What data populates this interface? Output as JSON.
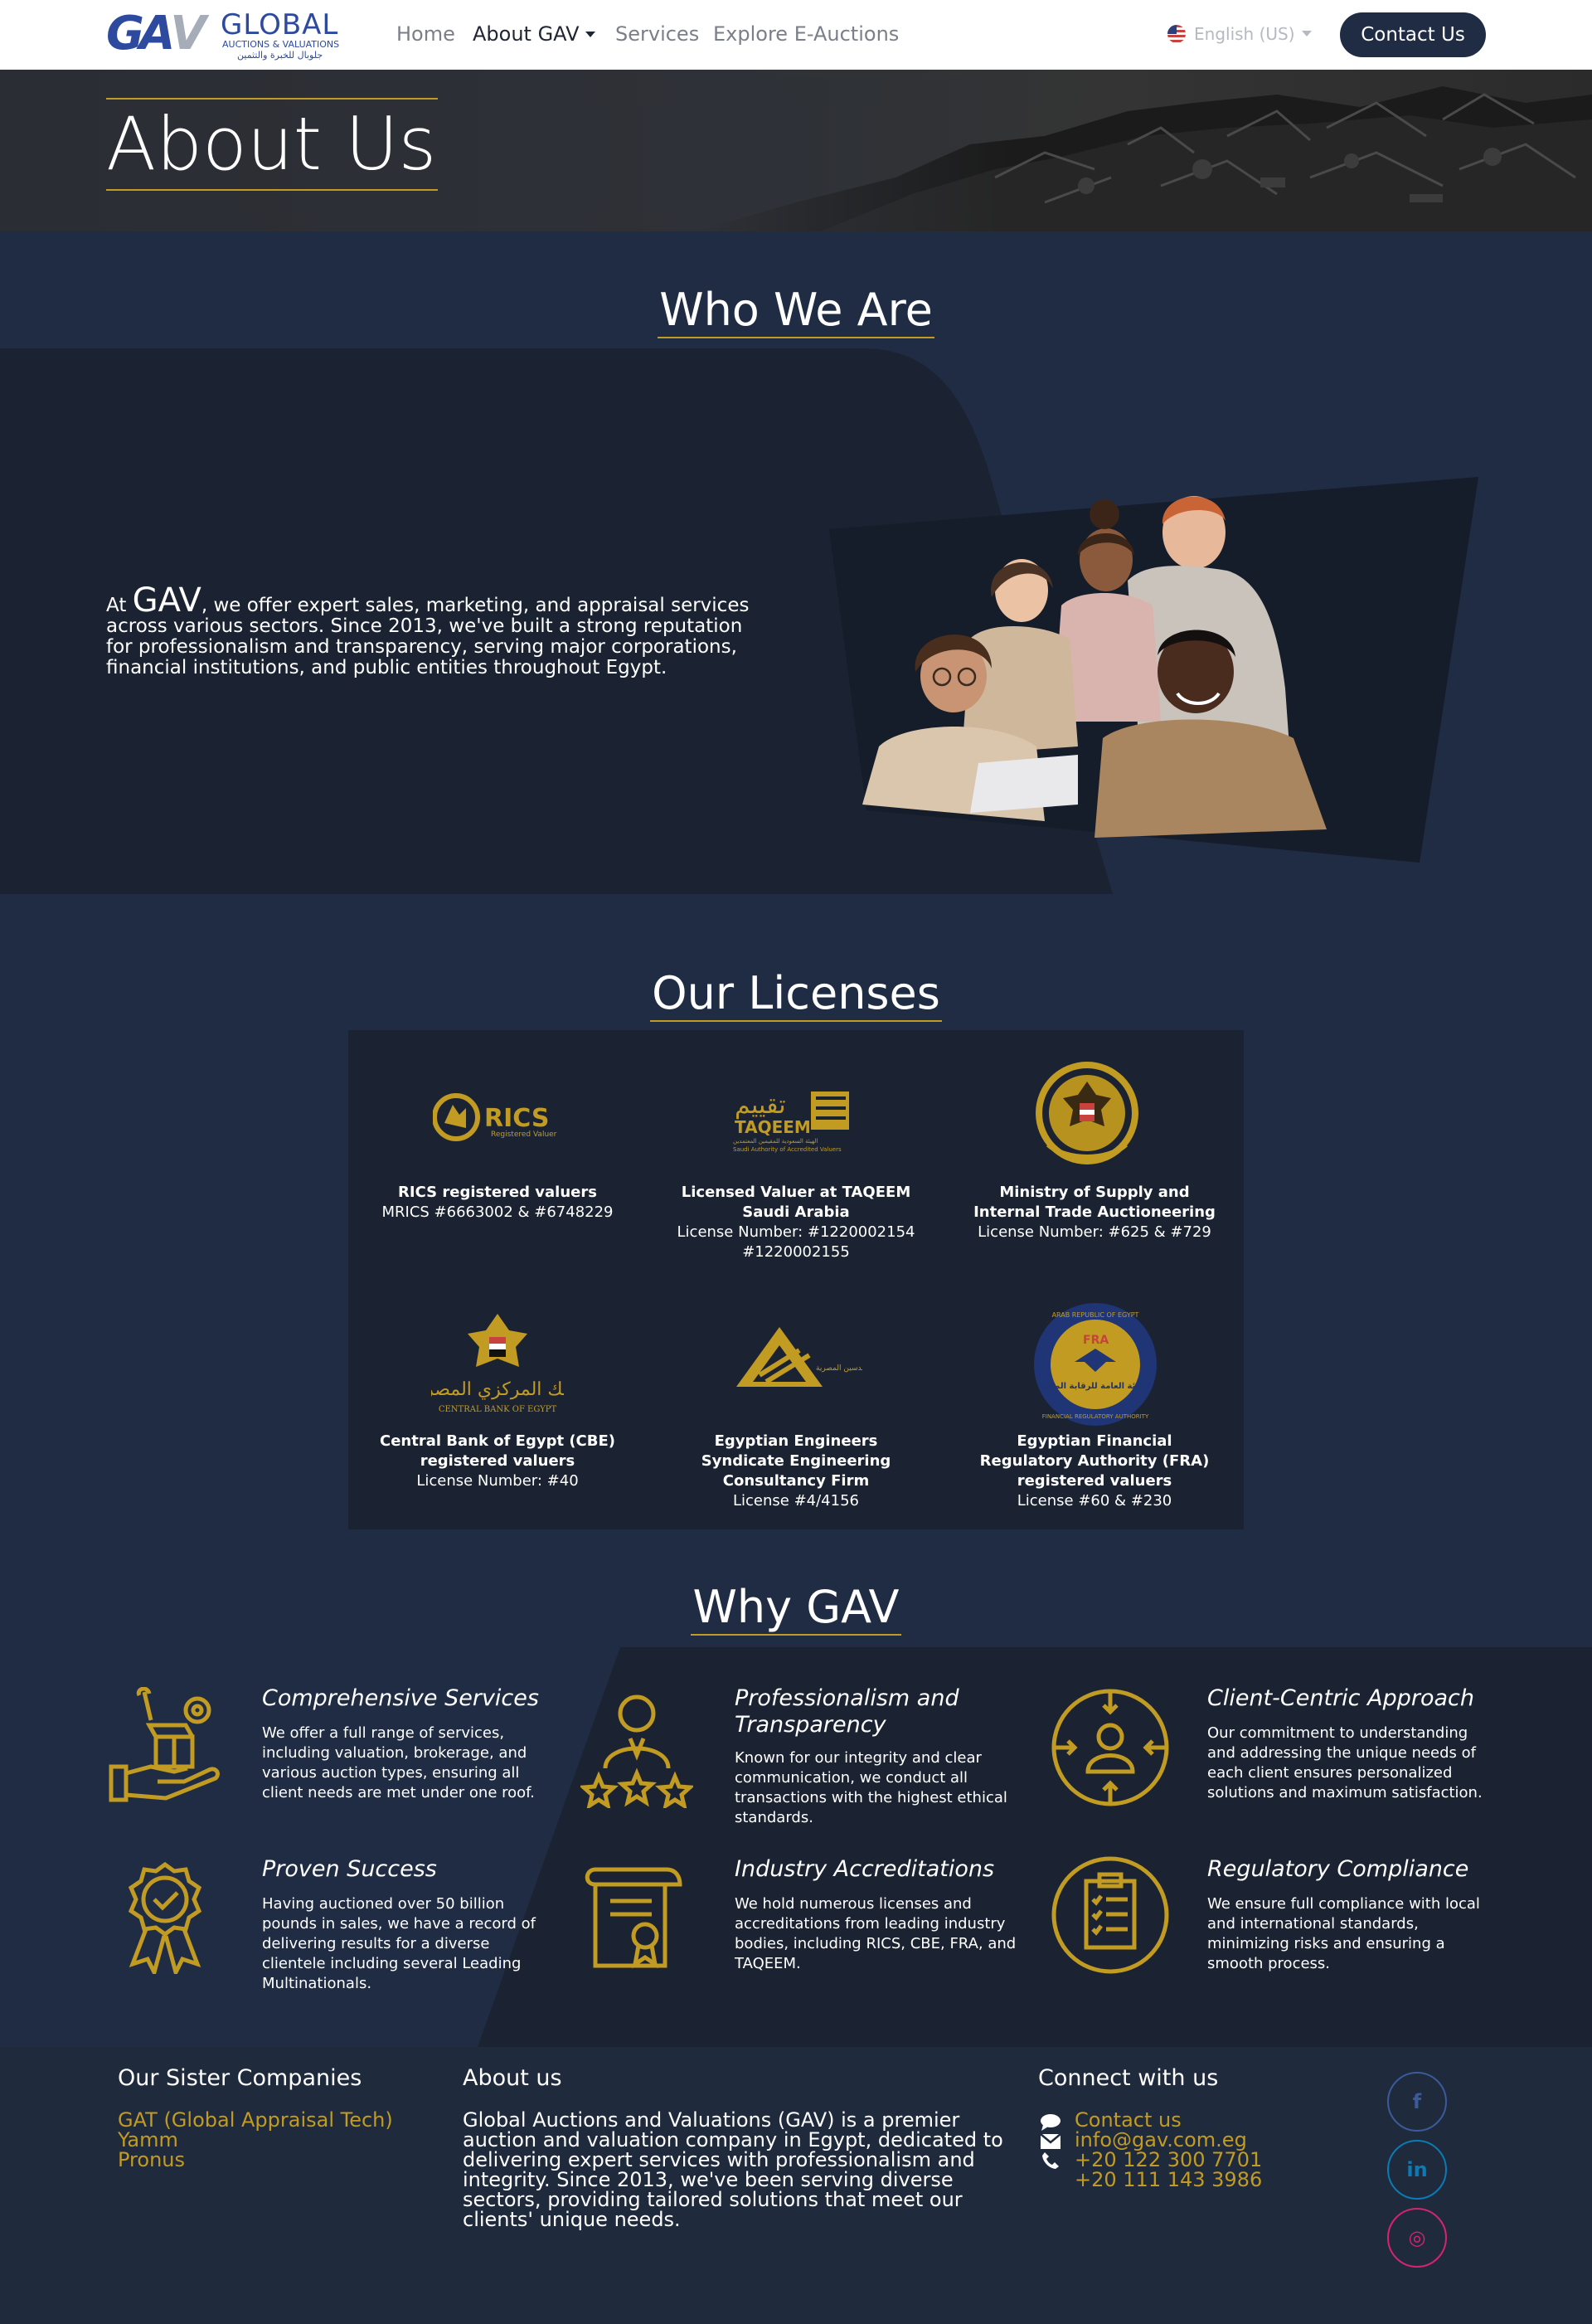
{
  "nav": {
    "logo_mark_left": "GA",
    "logo_mark_right": "V",
    "logo_name": "GLOBAL",
    "logo_sub": "AUCTIONS & VALUATIONS",
    "logo_ar": "جلوبال للخبرة والتثمين",
    "home": "Home",
    "about": "About GAV",
    "services": "Services",
    "explore": "Explore E-Auctions",
    "language": "English (US)",
    "contact": "Contact Us"
  },
  "hero": {
    "title": "About Us"
  },
  "who": {
    "title": "Who We Are",
    "at": "At ",
    "brand": "GAV",
    "text": ", we offer expert sales, marketing, and appraisal services across various sectors. Since 2013, we've built a strong reputation for professionalism and transparency, serving major corporations, financial institutions, and public entities throughout Egypt."
  },
  "licenses": {
    "title": "Our Licenses",
    "items": [
      {
        "logo": "RICS",
        "logo_sub": "Registered Valuer",
        "title": "RICS registered valuers",
        "detail": "MRICS #6663002 & #6748229"
      },
      {
        "logo": "TAQEEM",
        "logo_ar": "تقييم",
        "logo_sub": "الهيئة السعودية للمقيمين المعتمدين",
        "logo_sub2": "Saudi Authority of Accredited Valuers",
        "title": "Licensed Valuer at TAQEEM Saudi Arabia",
        "detail": "License Number: #1220002154 #1220002155"
      },
      {
        "title": "Ministry of Supply and Internal Trade Auctioneering",
        "detail": "License Number: #625 &  #729"
      },
      {
        "logo_ar": "البنك المركزي المصري",
        "logo_sub": "CENTRAL BANK OF EGYPT",
        "title": "Central Bank of Egypt (CBE) registered valuers",
        "detail": "License Number: #40"
      },
      {
        "logo_ar": "نقابة المهندسين المصرية",
        "title": "Egyptian Engineers Syndicate Engineering Consultancy Firm",
        "detail": "License #4/4156"
      },
      {
        "logo": "FRA",
        "logo_ar": "الهيئة العامة للرقابة المالية",
        "logo_ring_top": "ARAB REPUBLIC OF EGYPT",
        "logo_ring_bottom": "FINANCIAL REGULATORY AUTHORITY",
        "title": "Egyptian Financial Regulatory Authority (FRA) registered valuers",
        "detail": "License #60 & #230"
      }
    ]
  },
  "why": {
    "title": "Why GAV",
    "items": [
      {
        "icon": "hand-box-tools-icon",
        "title": "Comprehensive Services",
        "desc": "We offer a full range of services, including valuation, brokerage, and various auction types, ensuring all client needs are met under one roof."
      },
      {
        "icon": "person-stars-icon",
        "title": "Professionalism and Transparency",
        "desc": "Known for our integrity and clear communication, we conduct all transactions with the highest ethical standards."
      },
      {
        "icon": "person-target-icon",
        "title": "Client-Centric Approach",
        "desc": "Our commitment to understanding and addressing the unique needs of each client ensures personalized solutions and maximum satisfaction."
      },
      {
        "icon": "award-badge-icon",
        "title": "Proven Success",
        "desc": "Having auctioned over 50 billion pounds in sales, we have a record of delivering results for a diverse clientele including several Leading Multinationals."
      },
      {
        "icon": "certificate-scroll-icon",
        "title": "Industry Accreditations",
        "desc": "We hold numerous licenses and accreditations from leading industry bodies, including RICS, CBE, FRA, and TAQEEM."
      },
      {
        "icon": "clipboard-checklist-icon",
        "title": "Regulatory Compliance",
        "desc": "We ensure full compliance with local and international standards, minimizing risks and ensuring a smooth process."
      }
    ]
  },
  "footer": {
    "sister_title": "Our Sister Companies",
    "sister": [
      "GAT (Global Appraisal Tech)",
      "Yamm",
      "Pronus"
    ],
    "about_title": "About us",
    "about_text": "Global Auctions and Valuations (GAV) is a premier auction and valuation company in Egypt, dedicated to delivering expert services with professionalism and integrity. Since 2013, we've been serving diverse sectors, providing tailored solutions that meet our clients' unique needs.",
    "connect_title": "Connect with us",
    "contact_link": "Contact us",
    "email": "info@gav.com.eg",
    "phone1": "+20 122 300 7701",
    "phone2": "+20 111 143 3986",
    "social": [
      {
        "name": "facebook-icon",
        "glyph": "f",
        "color": "#3b5a9a"
      },
      {
        "name": "linkedin-icon",
        "glyph": "in",
        "color": "#0a7bb5"
      },
      {
        "name": "instagram-icon",
        "glyph": "◎",
        "color": "#d6246e"
      }
    ]
  },
  "colors": {
    "gold": "#c29b22",
    "navy": "#1f2c44",
    "panel": "#1b2333"
  }
}
